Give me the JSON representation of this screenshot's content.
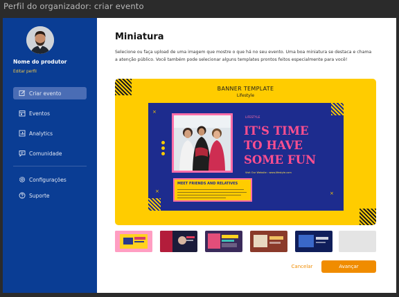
{
  "window": {
    "caption": "Perfil do organizador: criar evento"
  },
  "sidebar": {
    "producer_name": "Nome do produtor",
    "edit_profile_label": "Editar perfil",
    "items": [
      {
        "label": "Criar evento",
        "icon": "edit-icon",
        "active": true
      },
      {
        "label": "Eventos",
        "icon": "calendar-icon",
        "active": false
      },
      {
        "label": "Analytics",
        "icon": "chart-icon",
        "active": false
      },
      {
        "label": "Comunidade",
        "icon": "chat-icon",
        "active": false
      },
      {
        "label": "Configurações",
        "icon": "gear-icon",
        "active": false
      },
      {
        "label": "Suporte",
        "icon": "help-icon",
        "active": false
      }
    ]
  },
  "main": {
    "title": "Miniatura",
    "description": "Selecione ou faça upload de uma imagem que mostre o que há no seu evento. Uma boa miniatura se destaca e chama a atenção público. Você também pode selecionar alguns templates prontos feitos especialmente para você!",
    "preview": {
      "heading": "BANNER TEMPLATE",
      "subheading": "Lifestyle",
      "brand_tag": "LIFESTYLE",
      "headline_lines": [
        "IT'S TIME",
        "TO HAVE",
        "SOME FUN"
      ],
      "website": "Visit Our Website : www.lifestyle.com",
      "meet_title": "MEET FRIENDS AND RELATIVES"
    },
    "thumbnails": [
      {
        "name": "template-welcome",
        "selected": true
      },
      {
        "name": "template-lifestyle-red"
      },
      {
        "name": "template-welcome-dark"
      },
      {
        "name": "template-sale-brown"
      },
      {
        "name": "template-navy"
      },
      {
        "name": "template-empty"
      }
    ],
    "actions": {
      "cancel_label": "Cancelar",
      "next_label": "Avançar"
    }
  },
  "colors": {
    "sidebar_bg": "#0a3d94",
    "accent_orange": "#f08c00",
    "preview_yellow": "#ffcc00",
    "card_navy": "#1d2c8e",
    "pink": "#ff4f8f"
  }
}
